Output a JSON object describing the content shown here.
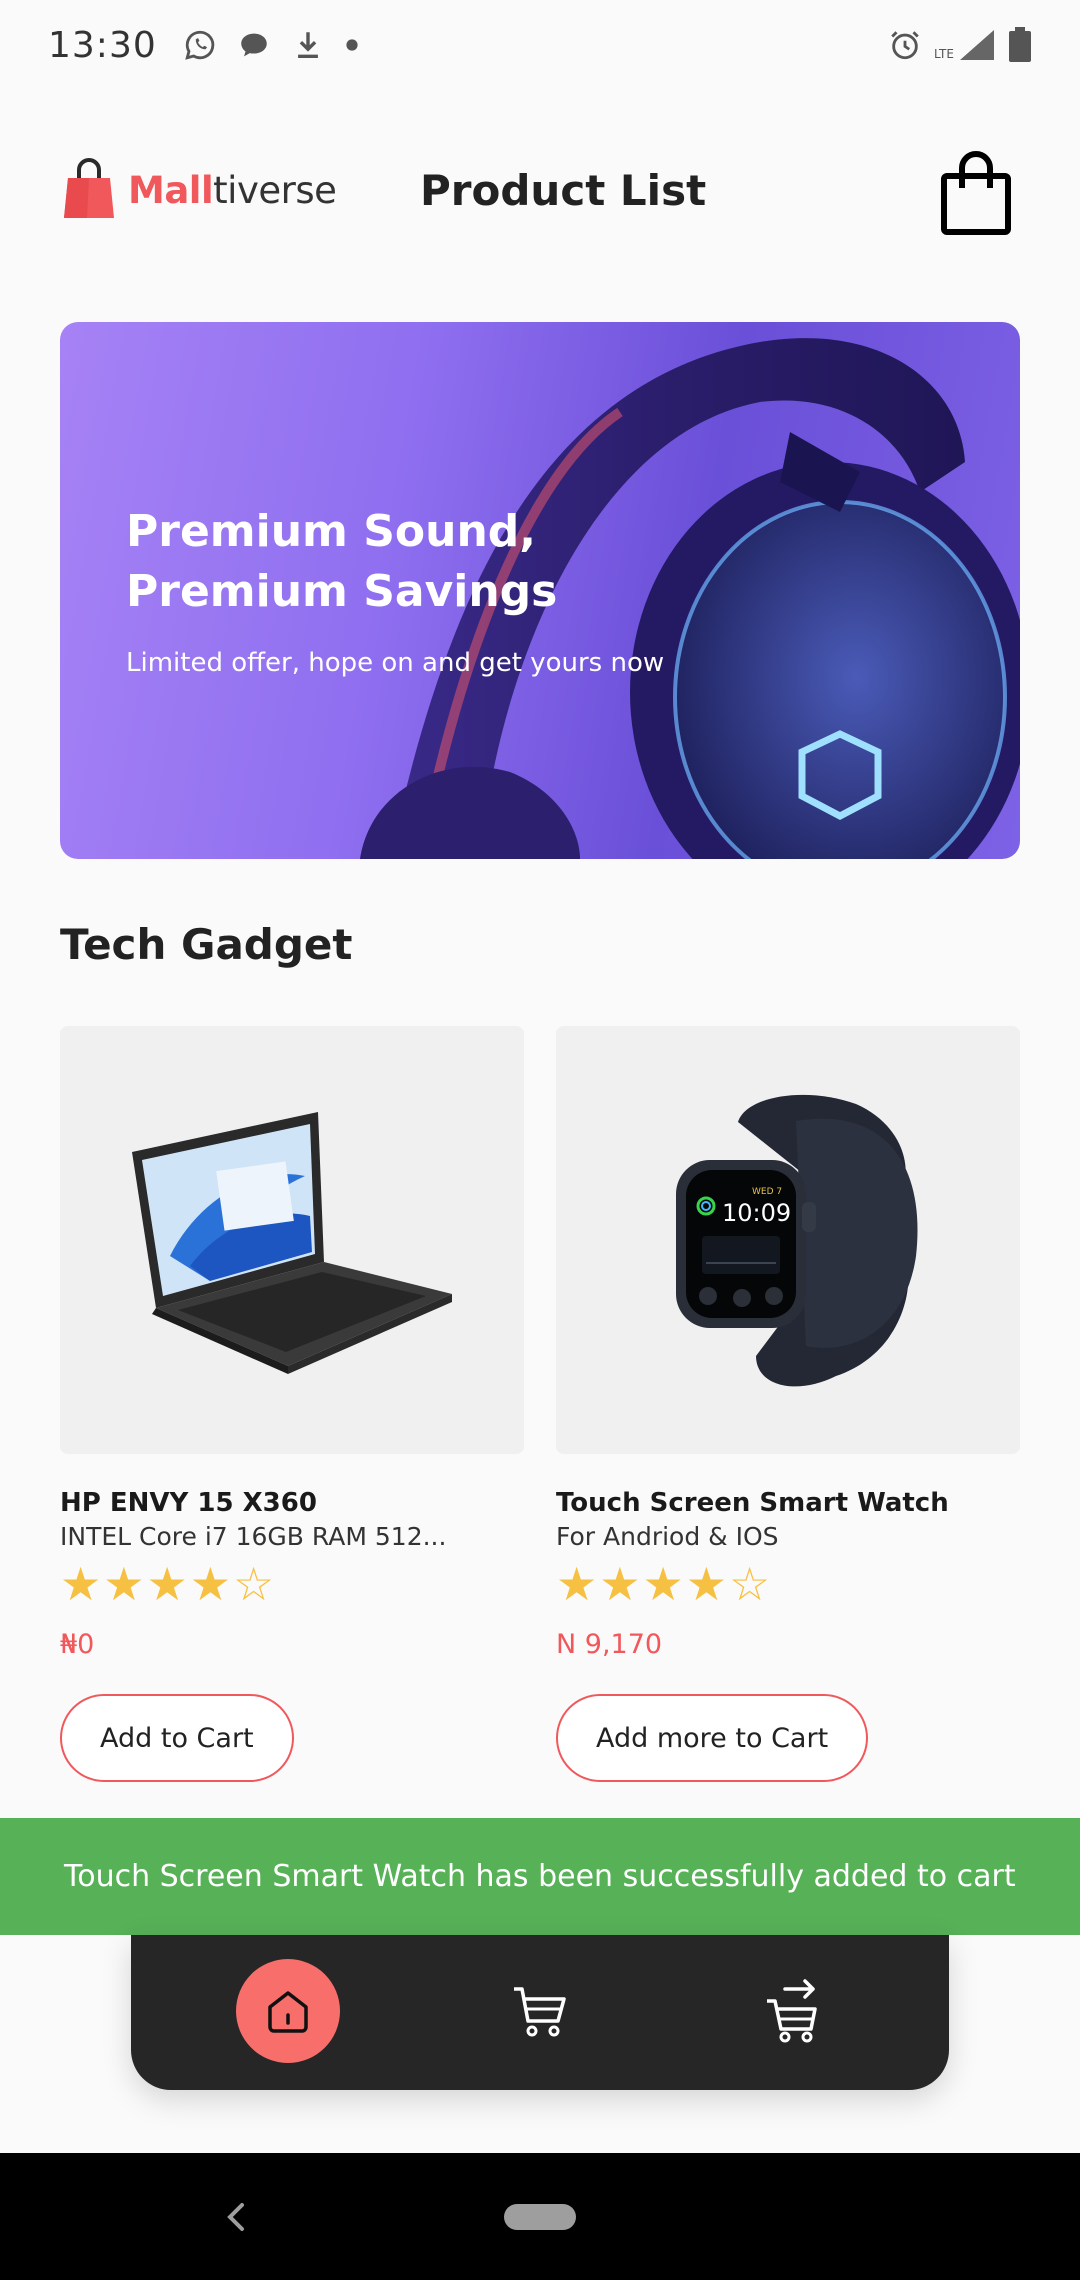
{
  "status_bar": {
    "time": "13:30",
    "network_label": "LTE"
  },
  "header": {
    "logo_mall": "Mall",
    "logo_tiverse": "tiverse",
    "title": "Product List"
  },
  "banner": {
    "title_line1": "Premium Sound,",
    "title_line2": "Premium Savings",
    "subtitle": "Limited offer, hope on and get yours now"
  },
  "section": {
    "title": "Tech Gadget"
  },
  "products": [
    {
      "name": "HP ENVY 15 X360",
      "description": "INTEL Core i7 16GB RAM 512...",
      "rating": 4,
      "rating_max": 5,
      "price": "₦0",
      "button_label": "Add to Cart"
    },
    {
      "name": "Touch Screen Smart Watch",
      "description": "For Andriod & IOS",
      "rating": 4,
      "rating_max": 5,
      "price": "N 9,170",
      "button_label": "Add more to Cart",
      "watch_date": "WED 7",
      "watch_time": "10:09"
    }
  ],
  "snackbar": {
    "message": "Touch Screen Smart Watch has been successfully added to cart"
  },
  "bottom_nav": {
    "items": [
      {
        "icon": "home-icon",
        "active": true
      },
      {
        "icon": "cart-icon",
        "active": false
      },
      {
        "icon": "checkout-cart-icon",
        "active": false
      }
    ]
  },
  "colors": {
    "accent": "#f0585b",
    "star": "#f6c042",
    "snackbar": "#57b157",
    "nav_bg": "#262626",
    "nav_active": "#f76e6b"
  }
}
